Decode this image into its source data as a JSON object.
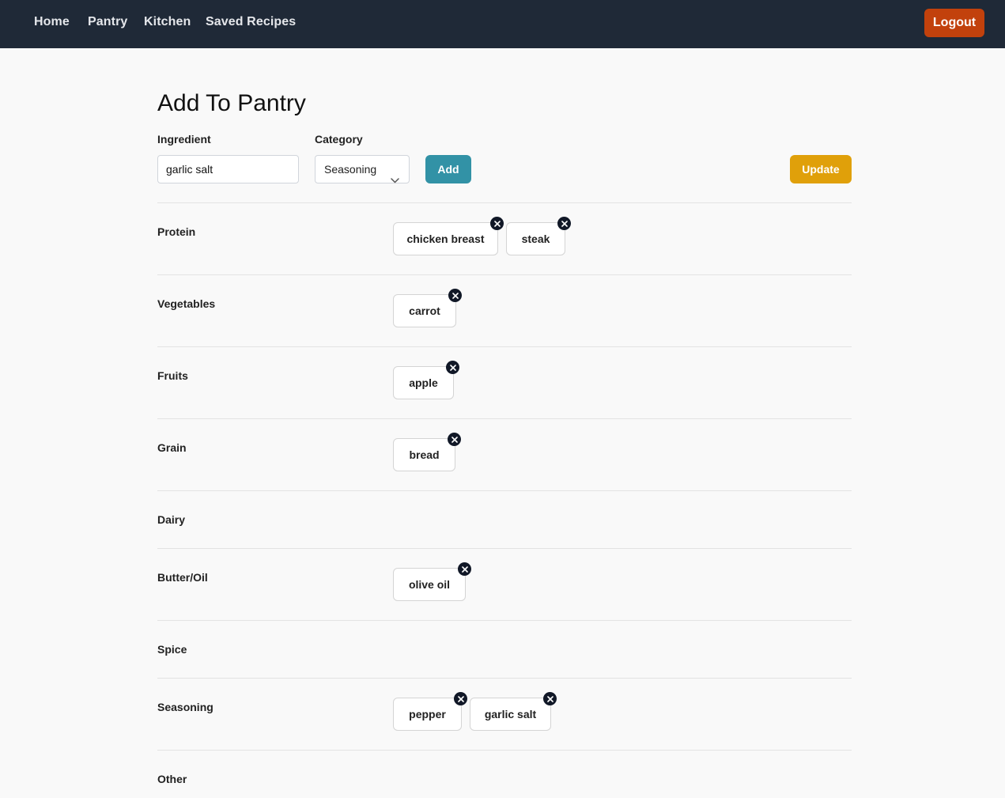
{
  "nav": {
    "links": [
      "Home",
      "Pantry",
      "Kitchen",
      "Saved Recipes"
    ],
    "logout_label": "Logout"
  },
  "form": {
    "title": "Add To Pantry",
    "ingredient_label": "Ingredient",
    "ingredient_value": "garlic salt",
    "category_label": "Category",
    "category_value": "Seasoning",
    "add_label": "Add",
    "update_label": "Update"
  },
  "categories": [
    {
      "name": "Protein",
      "items": [
        "chicken breast",
        "steak"
      ]
    },
    {
      "name": "Vegetables",
      "items": [
        "carrot"
      ]
    },
    {
      "name": "Fruits",
      "items": [
        "apple"
      ]
    },
    {
      "name": "Grain",
      "items": [
        "bread"
      ]
    },
    {
      "name": "Dairy",
      "items": []
    },
    {
      "name": "Butter/Oil",
      "items": [
        "olive oil"
      ]
    },
    {
      "name": "Spice",
      "items": []
    },
    {
      "name": "Seasoning",
      "items": [
        "pepper",
        "garlic salt"
      ]
    },
    {
      "name": "Other",
      "items": []
    }
  ],
  "icons": {
    "chip_remove": "close-icon",
    "select_arrow": "chevron-down-icon"
  },
  "colors": {
    "navbar": "#1f2937",
    "logout": "#c2410c",
    "add": "#3292a6",
    "update": "#e0a00a"
  }
}
